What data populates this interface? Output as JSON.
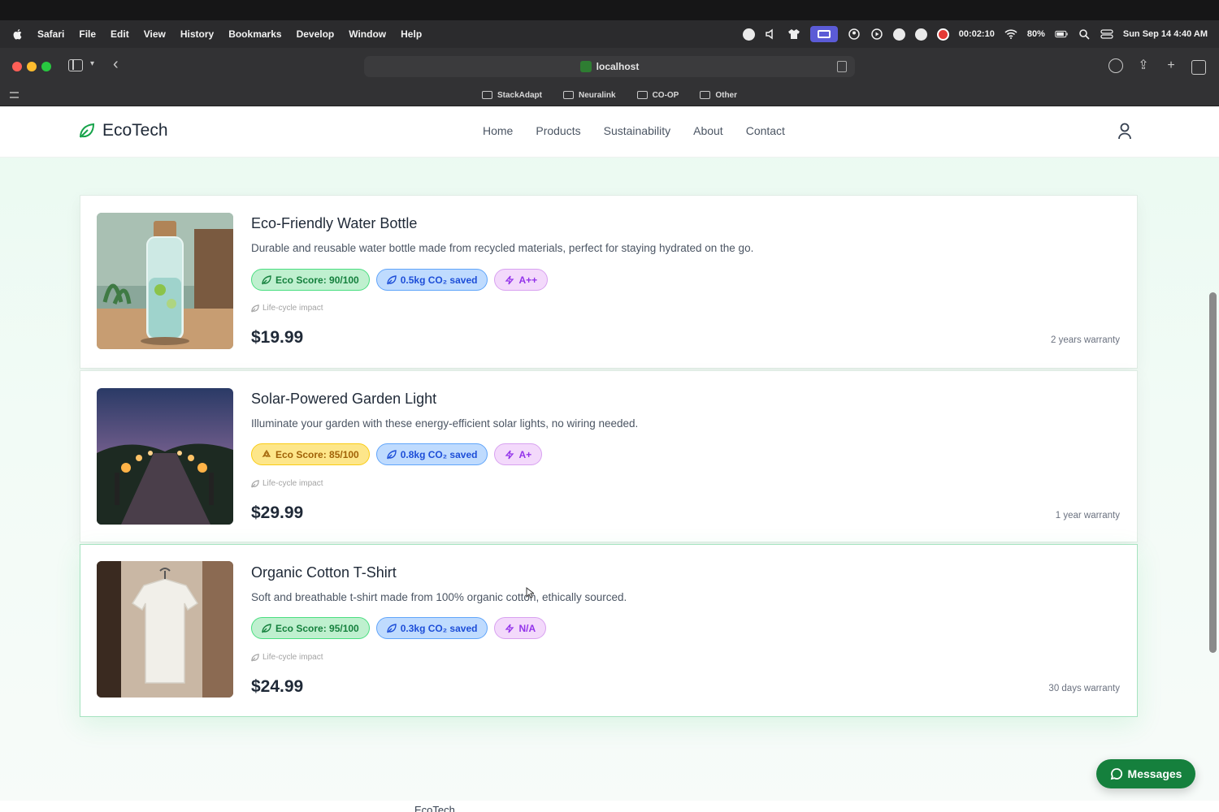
{
  "menubar": {
    "app_name": "Safari",
    "items": [
      "File",
      "Edit",
      "View",
      "History",
      "Bookmarks",
      "Develop",
      "Window",
      "Help"
    ],
    "timer": "00:02:10",
    "battery": "80%",
    "datetime": "Sun Sep 14  4:40 AM"
  },
  "browser": {
    "address": "localhost",
    "bookmarks": [
      "StackAdapt",
      "Neuralink",
      "CO-OP",
      "Other"
    ]
  },
  "site": {
    "brand": "EcoTech",
    "nav": [
      "Home",
      "Products",
      "Sustainability",
      "About",
      "Contact"
    ]
  },
  "products": [
    {
      "title": "Eco-Friendly Water Bottle",
      "description": "Durable and reusable water bottle made from recycled materials, perfect for staying hydrated on the go.",
      "eco_score": "Eco Score: 90/100",
      "co2": "0.5kg CO₂ saved",
      "rating": "A++",
      "lifecycle": "Life-cycle impact",
      "price": "$19.99",
      "warranty": "2 years warranty"
    },
    {
      "title": "Solar-Powered Garden Light",
      "description": "Illuminate your garden with these energy-efficient solar lights, no wiring needed.",
      "eco_score": "Eco Score: 85/100",
      "co2": "0.8kg CO₂ saved",
      "rating": "A+",
      "lifecycle": "Life-cycle impact",
      "price": "$29.99",
      "warranty": "1 year warranty"
    },
    {
      "title": "Organic Cotton T-Shirt",
      "description": "Soft and breathable t-shirt made from 100% organic cotton, ethically sourced.",
      "eco_score": "Eco Score: 95/100",
      "co2": "0.3kg CO₂ saved",
      "rating": "N/A",
      "lifecycle": "Life-cycle impact",
      "price": "$24.99",
      "warranty": "30 days warranty"
    }
  ],
  "footer_peek": "EcoTech",
  "messages_button": "Messages",
  "colors": {
    "brand_green": "#15803d",
    "eco_green_badge": "#bff0cf",
    "eco_yellow_badge": "#fde68a",
    "co2_badge": "#bfdbfe",
    "rating_badge": "#f3d9fb"
  }
}
